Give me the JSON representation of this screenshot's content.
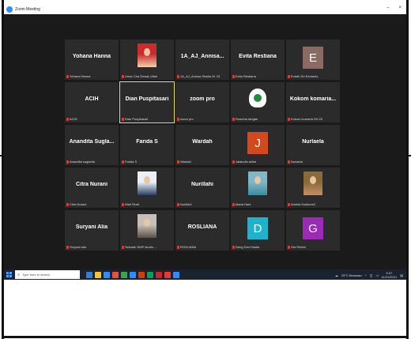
{
  "window": {
    "title": "Zoom Meeting",
    "controls": [
      "–",
      "×"
    ]
  },
  "participants": [
    {
      "name": "Yohana Hanna",
      "label": "Yohana Hanna",
      "type": "name"
    },
    {
      "name": "",
      "label": "Umar Cha Desak Ulfah",
      "type": "photo",
      "colors": [
        "#cc2b2b",
        "#f0d0b0"
      ]
    },
    {
      "name": "1A_AJ_Annisa...",
      "label": "1A_AJ_Annisa Shafar M. 23",
      "type": "name"
    },
    {
      "name": "Evita Restiana",
      "label": "Evita Restiana",
      "type": "name"
    },
    {
      "name": "",
      "label": "Endah Sri Kemanis",
      "type": "letter",
      "letter": "E",
      "color": "#8a6a62"
    },
    {
      "name": "ACIH",
      "label": "ACIH",
      "type": "name"
    },
    {
      "name": "Dian Puspitasari",
      "label": "Dian Puspitasari",
      "type": "name",
      "active": true
    },
    {
      "name": "zoom pro",
      "label": "zoom pro",
      "type": "name"
    },
    {
      "name": "",
      "label": "Rosmha tarigas",
      "type": "logo"
    },
    {
      "name": "Kokom komaria...",
      "label": "Kokom komaria SH.23",
      "type": "name"
    },
    {
      "name": "Anandita Sugla...",
      "label": "Anandita sugiartia",
      "type": "name"
    },
    {
      "name": "Farida S",
      "label": "Farida S",
      "type": "name"
    },
    {
      "name": "Wardah",
      "label": "Wardah",
      "type": "name"
    },
    {
      "name": "",
      "label": "Jalaludin arifat",
      "type": "letter",
      "letter": "J",
      "color": "#d2481f"
    },
    {
      "name": "Nurlaela",
      "label": "Nurlaela",
      "type": "name"
    },
    {
      "name": "Citra Nurani",
      "label": "Citra Nurani",
      "type": "name"
    },
    {
      "name": "",
      "label": "Wati Sindi",
      "type": "photo",
      "colors": [
        "#e9f0f6",
        "#2a3f60"
      ]
    },
    {
      "name": "Nurillahi",
      "label": "Nurillahi",
      "type": "name"
    },
    {
      "name": "",
      "label": "Maria Hani",
      "type": "photo",
      "colors": [
        "#7fb6c8",
        "#3c8ca0"
      ]
    },
    {
      "name": "",
      "label": "Amelia Dwihene2",
      "type": "photo",
      "colors": [
        "#8a6a3a",
        "#c09068"
      ]
    },
    {
      "name": "Suryani Alia",
      "label": "Suryani alia",
      "type": "name"
    },
    {
      "name": "",
      "label": "Sekolah SMP studio ...",
      "type": "photo",
      "colors": [
        "#c8c0b8",
        "#5a5048"
      ]
    },
    {
      "name": "ROSLIANA",
      "label": "ROSLIANA",
      "type": "name"
    },
    {
      "name": "",
      "label": "Deng Devi Nadia",
      "type": "letter",
      "letter": "D",
      "color": "#1db3cf"
    },
    {
      "name": "",
      "label": "Gia Rahmi",
      "type": "letter",
      "letter": "G",
      "color": "#9b2bb6"
    }
  ],
  "taskbar": {
    "search_placeholder": "Type here to search",
    "tray_text": "29°C Berawan",
    "time": "9:47",
    "date": "11/21/2021",
    "icon_colors": [
      "#3a7bd5",
      "#f0c43a",
      "#2d8cff",
      "#e5533d",
      "#3fa34d",
      "#2d8cff",
      "#d83b01",
      "#0f9d58",
      "#c62828",
      "#e53935",
      "#2d8cff"
    ]
  }
}
